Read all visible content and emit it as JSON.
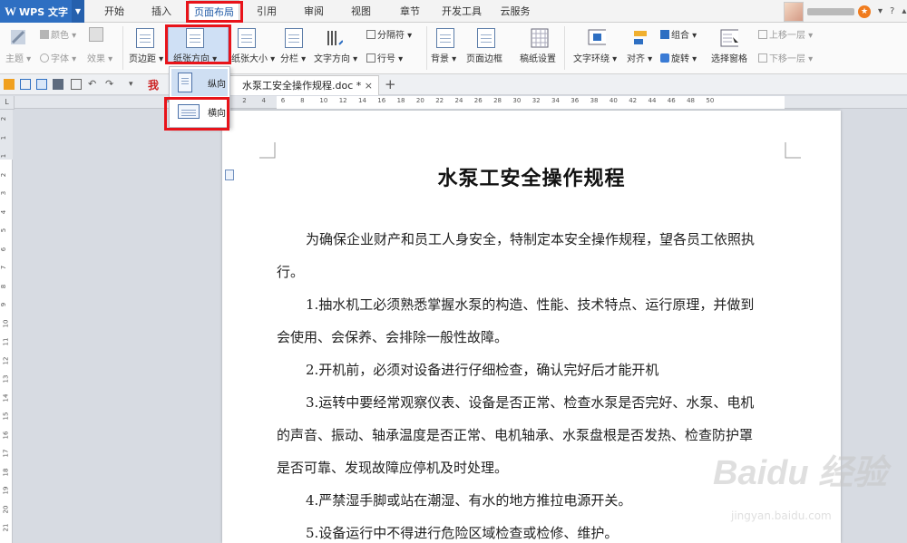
{
  "app": {
    "name": "WPS 文字"
  },
  "menu_tabs": [
    "开始",
    "插入",
    "页面布局",
    "引用",
    "审阅",
    "视图",
    "章节",
    "开发工具",
    "云服务"
  ],
  "active_tab": "页面布局",
  "ribbon": {
    "theme": "主题",
    "color": "颜色",
    "font": "字体",
    "effect": "效果",
    "margins": "页边距",
    "orientation": "纸张方向",
    "size": "纸张大小",
    "columns": "分栏",
    "text_direction": "文字方向",
    "breaks": "分隔符",
    "line_numbers": "行号",
    "background": "背景",
    "page_border": "页面边框",
    "grid_settings": "稿纸设置",
    "wrap_text": "文字环绕",
    "align": "对齐",
    "group": "组合",
    "rotate": "旋转",
    "selection_pane": "选择窗格",
    "bring_forward": "上移一层",
    "send_backward": "下移一层"
  },
  "orientation_menu": {
    "portrait": "纵向",
    "landscape": "横向"
  },
  "doc_tab": {
    "prefix": "我",
    "title": "水泵工安全操作规程.doc *",
    "close": "×",
    "new_tab": "+"
  },
  "ruler": {
    "corner": "L",
    "h_numbers": [
      "8",
      "6",
      "4",
      "2",
      "2",
      "4",
      "6",
      "8",
      "10",
      "12",
      "14",
      "16",
      "18",
      "20",
      "22",
      "24",
      "26",
      "28",
      "30",
      "32",
      "34",
      "36",
      "38",
      "40",
      "42",
      "44",
      "46",
      "48",
      "50"
    ],
    "v_numbers": [
      "2",
      "1",
      "1",
      "2",
      "3",
      "4",
      "5",
      "6",
      "7",
      "8",
      "9",
      "10",
      "11",
      "12",
      "13",
      "14",
      "15",
      "16",
      "17",
      "18",
      "19",
      "20",
      "21",
      "22",
      "23"
    ]
  },
  "document": {
    "title": "水泵工安全操作规程",
    "lines": [
      "为确保企业财产和员工人身安全，特制定本安全操作规程，望各员工依照执",
      "行。",
      "1.抽水机工必须熟悉掌握水泵的构造、性能、技术特点、运行原理，并做到",
      "会使用、会保养、会排除一般性故障。",
      "2.开机前，必须对设备进行仔细检查，确认完好后才能开机",
      "3.运转中要经常观察仪表、设备是否正常、检查水泵是否完好、水泵、电机",
      "的声音、振动、轴承温度是否正常、电机轴承、水泵盘根是否发热、检查防护罩",
      "是否可靠、发现故障应停机及时处理。",
      "4.严禁湿手脚或站在潮湿、有水的地方推拉电源开关。",
      "5.设备运行中不得进行危险区域检查或检修、维护。"
    ]
  },
  "watermark": {
    "brand": "Baidu 经验",
    "url": "jingyan.baidu.com"
  },
  "colors": {
    "accent_blue": "#2e6fc2",
    "highlight_red": "#e8131a"
  }
}
